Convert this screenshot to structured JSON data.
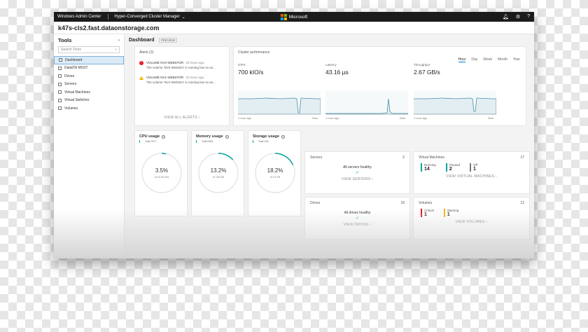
{
  "topbar": {
    "app_name": "Windows Admin Center",
    "manager": "Hyper-Converged Cluster Manager",
    "brand": "Microsoft"
  },
  "host": "k47s-cls2.fast.dataonstorage.com",
  "sidebar": {
    "title": "Tools",
    "search_placeholder": "Search Tools",
    "items": [
      {
        "label": "Dashboard"
      },
      {
        "label": "DataON MUST"
      },
      {
        "label": "Drives"
      },
      {
        "label": "Servers"
      },
      {
        "label": "Virtual Machines"
      },
      {
        "label": "Virtual Switches"
      },
      {
        "label": "Volumes"
      }
    ]
  },
  "dashboard": {
    "title": "Dashboard",
    "badge": "PREVIEW",
    "alerts": {
      "title": "Alerts (2)",
      "items": [
        {
          "name": "VOLUME NV2-WEBSTOR",
          "time": "20 hours ago",
          "text": "The volume 'NV2-WebStor' is running low on av...",
          "severity": "critical"
        },
        {
          "name": "VOLUME NV1-WEBSTOR",
          "time": "20 hours ago",
          "text": "The volume 'NV1-WebStor' is running low on av...",
          "severity": "warning"
        }
      ],
      "link": "VIEW ALL ALERTS"
    },
    "performance": {
      "title": "Cluster performance",
      "tabs": [
        "Hour",
        "Day",
        "Week",
        "Month",
        "Year"
      ],
      "active_tab": "Hour",
      "metrics": [
        {
          "label": "IOPS",
          "value": "700 kIO/s",
          "axis_start": "1 hour ago",
          "axis_end": "Now"
        },
        {
          "label": "Latency",
          "value": "43.16 µs",
          "axis_start": "1 hour ago",
          "axis_end": "Now"
        },
        {
          "label": "Throughput",
          "value": "2.67 GB/s",
          "axis_start": "1 hour ago",
          "axis_end": "Now"
        }
      ]
    },
    "gauges": [
      {
        "title": "CPU usage",
        "legend": "Total CPU",
        "value": "3.5%",
        "of": "of 14.06 GHz",
        "fraction": 0.035
      },
      {
        "title": "Memory usage",
        "legend": "Total RAM",
        "value": "13.2%",
        "of": "of 128 GB",
        "fraction": 0.132
      },
      {
        "title": "Storage usage",
        "legend": "Total VOL",
        "value": "18.2%",
        "of": "of 2.5 TB",
        "fraction": 0.182
      }
    ],
    "servers": {
      "title": "Servers",
      "count": "2",
      "status": "All servers healthy",
      "link": "VIEW SERVERS"
    },
    "drives": {
      "title": "Drives",
      "count": "16",
      "status": "All drives healthy",
      "link": "VIEW DRIVES"
    },
    "vms": {
      "title": "Virtual Machines",
      "count": "17",
      "link": "VIEW VIRTUAL MACHINES",
      "stats": [
        {
          "label": "Running",
          "value": "14",
          "color": "#00a59a"
        },
        {
          "label": "Paused",
          "value": "2",
          "color": "#00a59a"
        },
        {
          "label": "Off",
          "value": "1",
          "color": "#777777"
        }
      ]
    },
    "volumes": {
      "title": "Volumes",
      "count": "12",
      "link": "VIEW VOLUMES",
      "stats": [
        {
          "label": "Critical",
          "value": "1",
          "color": "#e81123"
        },
        {
          "label": "Warning",
          "value": "1",
          "color": "#f2b400"
        }
      ]
    }
  },
  "colors": {
    "accent": "#00a59a",
    "critical": "#e81123",
    "warning": "#f2b400",
    "chart_line": "#4a8fa8"
  }
}
